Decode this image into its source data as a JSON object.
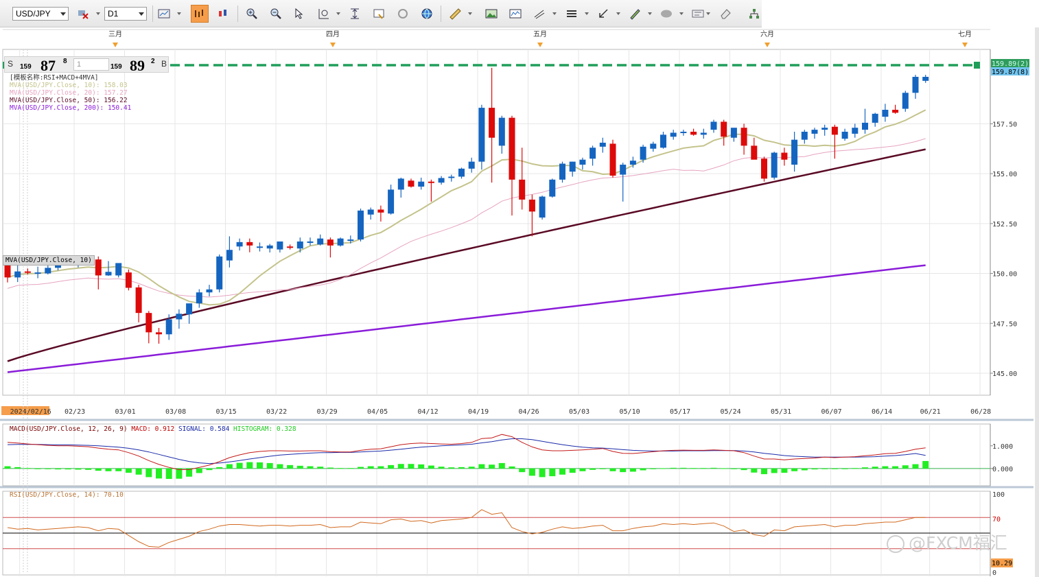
{
  "toolbar": {
    "symbol": "USD/JPY",
    "timeframe": "D1",
    "buttons": [
      "chart-type-icon",
      "bar-chart-icon",
      "candle-chart-icon",
      "zoom-in-icon",
      "zoom-out-icon",
      "cursor-icon",
      "zoom-range-icon",
      "fit-icon",
      "chart-window-icon",
      "refresh-icon",
      "globe-icon",
      "ruler-icon",
      "picture-icon",
      "indicator-window-icon",
      "draw-lines-icon",
      "horizontal-lines-icon",
      "arrow-icon",
      "pen-icon",
      "shape-icon",
      "text-icon",
      "eraser-icon",
      "tree-icon",
      "menu-icon"
    ]
  },
  "quote": {
    "sell_label": "S",
    "buy_label": "B",
    "sell_prefix": "159",
    "sell_big": "87",
    "sell_pip": "8",
    "buy_prefix": "159",
    "buy_big": "89",
    "buy_pip": "2",
    "amount": "1"
  },
  "legend": {
    "template": "[模板名称:RSI+MACD+4MVA]",
    "lines": [
      {
        "text": "MVA(USD/JPY.Close, 10): 158.03",
        "color": "#c4c38c"
      },
      {
        "text": "MVA(USD/JPY.Close, 20): 157.27",
        "color": "#e6a3c0"
      },
      {
        "text": "MVA(USD/JPY.Close, 50): 156.22",
        "color": "#5a0a24"
      },
      {
        "text": "MVA(USD/JPY.Close, 200): 150.41",
        "color": "#8a1cd9"
      }
    ]
  },
  "ma_tag": "MVA(USD/JPY.Close, 10)",
  "watermark": "@FXCM福汇",
  "chart_data": {
    "type": "candlestick",
    "symbol": "USD/JPY",
    "timeframe": "D1",
    "ylim": [
      143.9,
      161.5
    ],
    "y_ticks": [
      "145.00",
      "147.50",
      "150.00",
      "152.50",
      "155.00",
      "157.50"
    ],
    "x_ticks": [
      "2024/02/16",
      "02/23",
      "03/01",
      "03/08",
      "03/15",
      "03/22",
      "03/29",
      "04/05",
      "04/12",
      "04/19",
      "04/26",
      "05/03",
      "05/10",
      "05/17",
      "05/24",
      "05/31",
      "06/07",
      "06/14",
      "06/21",
      "06/28"
    ],
    "month_markers": [
      "三月",
      "四月",
      "五月",
      "六月",
      "七月"
    ],
    "last_price_label": "159.87(8)",
    "ask_price_label": "159.89(2)",
    "colors": {
      "up": "#1565c0",
      "down": "#dd0a0a",
      "ma10": "#c4c38c",
      "ma20": "#e6a3c0",
      "ma50": "#5a0a24",
      "ma200": "#8a1cd9",
      "line": "#1f9e5a"
    },
    "candles": [
      {
        "o": 150.5,
        "h": 150.7,
        "l": 149.55,
        "c": 149.8
      },
      {
        "o": 149.8,
        "h": 150.48,
        "l": 149.57,
        "c": 150.1
      },
      {
        "o": 150.1,
        "h": 150.25,
        "l": 149.95,
        "c": 150.05
      },
      {
        "o": 150.05,
        "h": 150.34,
        "l": 149.76,
        "c": 150.05
      },
      {
        "o": 150.0,
        "h": 150.45,
        "l": 149.95,
        "c": 150.28
      },
      {
        "o": 150.28,
        "h": 150.8,
        "l": 150.15,
        "c": 150.55
      },
      {
        "o": 150.55,
        "h": 150.85,
        "l": 150.4,
        "c": 150.7
      },
      {
        "o": 150.5,
        "h": 150.75,
        "l": 150.3,
        "c": 150.62
      },
      {
        "o": 150.65,
        "h": 150.88,
        "l": 150.45,
        "c": 150.75
      },
      {
        "o": 150.7,
        "h": 150.85,
        "l": 149.2,
        "c": 149.9
      },
      {
        "o": 149.9,
        "h": 150.62,
        "l": 149.88,
        "c": 150.08
      },
      {
        "o": 149.9,
        "h": 150.48,
        "l": 149.8,
        "c": 150.52
      },
      {
        "o": 150.05,
        "h": 150.2,
        "l": 149.15,
        "c": 149.28
      },
      {
        "o": 149.3,
        "h": 149.43,
        "l": 147.55,
        "c": 148.02
      },
      {
        "o": 148.02,
        "h": 148.12,
        "l": 146.5,
        "c": 147.05
      },
      {
        "o": 147.05,
        "h": 147.27,
        "l": 146.48,
        "c": 146.95
      },
      {
        "o": 146.95,
        "h": 147.95,
        "l": 146.67,
        "c": 147.7
      },
      {
        "o": 147.7,
        "h": 148.2,
        "l": 147.23,
        "c": 147.98
      },
      {
        "o": 147.95,
        "h": 148.45,
        "l": 147.48,
        "c": 148.5
      },
      {
        "o": 148.5,
        "h": 149.21,
        "l": 148.28,
        "c": 149.05
      },
      {
        "o": 149.05,
        "h": 149.43,
        "l": 148.85,
        "c": 149.2
      },
      {
        "o": 149.2,
        "h": 150.95,
        "l": 149.05,
        "c": 150.85
      },
      {
        "o": 150.65,
        "h": 151.86,
        "l": 150.3,
        "c": 151.18
      },
      {
        "o": 151.35,
        "h": 151.75,
        "l": 151.15,
        "c": 151.57
      },
      {
        "o": 151.57,
        "h": 151.75,
        "l": 151.06,
        "c": 151.4
      },
      {
        "o": 151.3,
        "h": 151.55,
        "l": 151.1,
        "c": 151.35
      },
      {
        "o": 151.25,
        "h": 151.48,
        "l": 151.05,
        "c": 151.4
      },
      {
        "o": 151.2,
        "h": 151.55,
        "l": 151.05,
        "c": 151.6
      },
      {
        "o": 151.35,
        "h": 151.45,
        "l": 151.2,
        "c": 151.3
      },
      {
        "o": 151.25,
        "h": 151.8,
        "l": 151.05,
        "c": 151.6
      },
      {
        "o": 151.55,
        "h": 151.8,
        "l": 151.4,
        "c": 151.6
      },
      {
        "o": 151.45,
        "h": 151.95,
        "l": 151.4,
        "c": 151.75
      },
      {
        "o": 151.7,
        "h": 151.8,
        "l": 150.8,
        "c": 151.4
      },
      {
        "o": 151.4,
        "h": 151.8,
        "l": 151.35,
        "c": 151.75
      },
      {
        "o": 151.68,
        "h": 151.9,
        "l": 151.5,
        "c": 151.7
      },
      {
        "o": 151.7,
        "h": 153.25,
        "l": 151.6,
        "c": 153.15
      },
      {
        "o": 152.95,
        "h": 153.3,
        "l": 152.7,
        "c": 153.2
      },
      {
        "o": 153.2,
        "h": 153.4,
        "l": 152.6,
        "c": 153.05
      },
      {
        "o": 153.0,
        "h": 154.45,
        "l": 152.95,
        "c": 154.2
      },
      {
        "o": 154.2,
        "h": 154.8,
        "l": 153.8,
        "c": 154.75
      },
      {
        "o": 154.65,
        "h": 154.75,
        "l": 154.3,
        "c": 154.35
      },
      {
        "o": 154.35,
        "h": 154.8,
        "l": 154.2,
        "c": 154.6
      },
      {
        "o": 154.6,
        "h": 154.7,
        "l": 153.6,
        "c": 154.55
      },
      {
        "o": 154.55,
        "h": 154.88,
        "l": 154.45,
        "c": 154.78
      },
      {
        "o": 154.8,
        "h": 154.95,
        "l": 154.6,
        "c": 154.85
      },
      {
        "o": 154.85,
        "h": 155.3,
        "l": 154.75,
        "c": 155.25
      },
      {
        "o": 155.25,
        "h": 155.8,
        "l": 155.05,
        "c": 155.6
      },
      {
        "o": 155.6,
        "h": 158.45,
        "l": 155.2,
        "c": 158.3
      },
      {
        "o": 158.3,
        "h": 160.3,
        "l": 154.55,
        "c": 156.8
      },
      {
        "o": 156.4,
        "h": 157.9,
        "l": 156.0,
        "c": 157.8
      },
      {
        "o": 157.8,
        "h": 157.9,
        "l": 152.9,
        "c": 154.7
      },
      {
        "o": 154.7,
        "h": 156.3,
        "l": 153.2,
        "c": 153.7
      },
      {
        "o": 153.7,
        "h": 153.95,
        "l": 151.86,
        "c": 153.1
      },
      {
        "o": 152.8,
        "h": 153.9,
        "l": 152.7,
        "c": 153.85
      },
      {
        "o": 153.85,
        "h": 154.75,
        "l": 153.8,
        "c": 154.7
      },
      {
        "o": 154.7,
        "h": 155.6,
        "l": 154.55,
        "c": 155.5
      },
      {
        "o": 155.1,
        "h": 155.6,
        "l": 154.85,
        "c": 155.6
      },
      {
        "o": 155.45,
        "h": 155.8,
        "l": 155.2,
        "c": 155.7
      },
      {
        "o": 155.75,
        "h": 156.4,
        "l": 155.4,
        "c": 156.3
      },
      {
        "o": 156.35,
        "h": 156.8,
        "l": 156.05,
        "c": 156.55
      },
      {
        "o": 156.5,
        "h": 156.7,
        "l": 154.8,
        "c": 154.9
      },
      {
        "o": 154.95,
        "h": 155.55,
        "l": 153.6,
        "c": 155.45
      },
      {
        "o": 155.45,
        "h": 155.85,
        "l": 155.3,
        "c": 155.65
      },
      {
        "o": 155.7,
        "h": 156.45,
        "l": 155.55,
        "c": 156.35
      },
      {
        "o": 156.25,
        "h": 156.6,
        "l": 156.1,
        "c": 156.5
      },
      {
        "o": 156.3,
        "h": 157.1,
        "l": 156.25,
        "c": 156.95
      },
      {
        "o": 156.85,
        "h": 157.2,
        "l": 156.7,
        "c": 157.05
      },
      {
        "o": 157.05,
        "h": 157.2,
        "l": 156.9,
        "c": 157.1
      },
      {
        "o": 157.1,
        "h": 157.25,
        "l": 156.9,
        "c": 156.95
      },
      {
        "o": 156.95,
        "h": 157.25,
        "l": 156.75,
        "c": 157.05
      },
      {
        "o": 157.2,
        "h": 157.7,
        "l": 157.05,
        "c": 157.6
      },
      {
        "o": 157.6,
        "h": 157.7,
        "l": 156.4,
        "c": 156.85
      },
      {
        "o": 156.8,
        "h": 157.15,
        "l": 156.6,
        "c": 157.3
      },
      {
        "o": 157.3,
        "h": 157.5,
        "l": 155.95,
        "c": 156.4
      },
      {
        "o": 156.4,
        "h": 156.8,
        "l": 155.85,
        "c": 155.7
      },
      {
        "o": 155.75,
        "h": 155.85,
        "l": 154.6,
        "c": 154.75
      },
      {
        "o": 154.8,
        "h": 156.1,
        "l": 154.7,
        "c": 156.05
      },
      {
        "o": 156.05,
        "h": 156.3,
        "l": 155.4,
        "c": 155.7
      },
      {
        "o": 155.45,
        "h": 157.1,
        "l": 155.1,
        "c": 156.7
      },
      {
        "o": 156.7,
        "h": 157.2,
        "l": 156.5,
        "c": 157.1
      },
      {
        "o": 157.0,
        "h": 157.3,
        "l": 156.75,
        "c": 157.2
      },
      {
        "o": 157.2,
        "h": 157.45,
        "l": 156.9,
        "c": 157.3
      },
      {
        "o": 157.35,
        "h": 157.45,
        "l": 155.75,
        "c": 156.95
      },
      {
        "o": 156.75,
        "h": 157.25,
        "l": 156.65,
        "c": 157.1
      },
      {
        "o": 157.0,
        "h": 157.5,
        "l": 156.8,
        "c": 157.3
      },
      {
        "o": 157.2,
        "h": 158.25,
        "l": 157.0,
        "c": 157.55
      },
      {
        "o": 157.55,
        "h": 158.05,
        "l": 157.35,
        "c": 158.0
      },
      {
        "o": 157.85,
        "h": 158.5,
        "l": 157.6,
        "c": 158.2
      },
      {
        "o": 158.2,
        "h": 158.45,
        "l": 158.0,
        "c": 158.05
      },
      {
        "o": 158.25,
        "h": 159.15,
        "l": 158.1,
        "c": 159.05
      },
      {
        "o": 159.05,
        "h": 159.95,
        "l": 158.75,
        "c": 159.85
      },
      {
        "o": 159.65,
        "h": 159.95,
        "l": 159.55,
        "c": 159.85
      }
    ],
    "ma_end_values": {
      "ma10": 158.03,
      "ma20": 157.27,
      "ma50": 156.22,
      "ma200": 150.41
    },
    "macd": {
      "label": "MACD(USD/JPY.Close, 12, 26, 9)",
      "macd_text": "MACD: 0.912",
      "signal_text": "SIGNAL: 0.584",
      "histogram_text": "HISTOGRAM: 0.328",
      "ylim": [
        -0.7,
        1.9
      ],
      "y_ticks": [
        "1.000",
        "0.000"
      ],
      "macd": [
        1.15,
        1.12,
        1.08,
        1.05,
        1.02,
        1.0,
        1.0,
        0.98,
        0.96,
        0.9,
        0.85,
        0.82,
        0.7,
        0.55,
        0.35,
        0.18,
        0.05,
        -0.05,
        -0.05,
        0.05,
        0.15,
        0.3,
        0.48,
        0.6,
        0.7,
        0.75,
        0.78,
        0.78,
        0.77,
        0.77,
        0.78,
        0.78,
        0.74,
        0.73,
        0.73,
        0.8,
        0.85,
        0.87,
        0.96,
        1.05,
        1.1,
        1.12,
        1.1,
        1.08,
        1.07,
        1.1,
        1.15,
        1.32,
        1.35,
        1.5,
        1.4,
        1.15,
        0.95,
        0.82,
        0.78,
        0.78,
        0.8,
        0.82,
        0.85,
        0.88,
        0.75,
        0.67,
        0.66,
        0.7,
        0.74,
        0.78,
        0.8,
        0.81,
        0.8,
        0.8,
        0.82,
        0.8,
        0.78,
        0.7,
        0.55,
        0.42,
        0.42,
        0.38,
        0.42,
        0.44,
        0.46,
        0.5,
        0.48,
        0.5,
        0.52,
        0.56,
        0.6,
        0.65,
        0.67,
        0.75,
        0.85,
        0.91
      ],
      "signal": [
        1.05,
        1.06,
        1.06,
        1.06,
        1.05,
        1.04,
        1.04,
        1.03,
        1.02,
        1.0,
        0.97,
        0.94,
        0.89,
        0.82,
        0.73,
        0.62,
        0.51,
        0.4,
        0.31,
        0.25,
        0.22,
        0.24,
        0.29,
        0.35,
        0.42,
        0.48,
        0.54,
        0.59,
        0.62,
        0.65,
        0.68,
        0.7,
        0.7,
        0.71,
        0.71,
        0.73,
        0.75,
        0.77,
        0.81,
        0.85,
        0.9,
        0.94,
        0.97,
        1.0,
        1.02,
        1.04,
        1.07,
        1.13,
        1.18,
        1.26,
        1.31,
        1.31,
        1.27,
        1.2,
        1.12,
        1.05,
        0.99,
        0.94,
        0.91,
        0.9,
        0.87,
        0.83,
        0.8,
        0.78,
        0.77,
        0.77,
        0.77,
        0.78,
        0.78,
        0.78,
        0.79,
        0.79,
        0.79,
        0.77,
        0.73,
        0.67,
        0.62,
        0.57,
        0.54,
        0.52,
        0.5,
        0.5,
        0.5,
        0.5,
        0.5,
        0.51,
        0.52,
        0.55,
        0.57,
        0.61,
        0.66,
        0.58
      ]
    },
    "rsi": {
      "label": "RSI(USD/JPY.Close, 14): 70.10",
      "ylim": [
        0,
        100
      ],
      "levels": [
        70,
        50,
        30
      ],
      "y_ticks": [
        "100",
        "70",
        "10.29",
        "0"
      ],
      "values": [
        57,
        55,
        56,
        54,
        55,
        56,
        57,
        58,
        57,
        53,
        56,
        55,
        47,
        39,
        33,
        32,
        38,
        42,
        46,
        52,
        55,
        59,
        61,
        61,
        60,
        59,
        60,
        60,
        59,
        60,
        60,
        61,
        57,
        58,
        58,
        64,
        63,
        62,
        67,
        68,
        65,
        66,
        63,
        66,
        67,
        68,
        70,
        80,
        74,
        76,
        57,
        52,
        49,
        51,
        55,
        58,
        56,
        57,
        59,
        60,
        53,
        53,
        56,
        58,
        59,
        62,
        61,
        62,
        61,
        62,
        63,
        59,
        52,
        54,
        48,
        46,
        54,
        53,
        58,
        59,
        60,
        61,
        58,
        60,
        60,
        62,
        63,
        64,
        64,
        67,
        70,
        70
      ]
    }
  }
}
